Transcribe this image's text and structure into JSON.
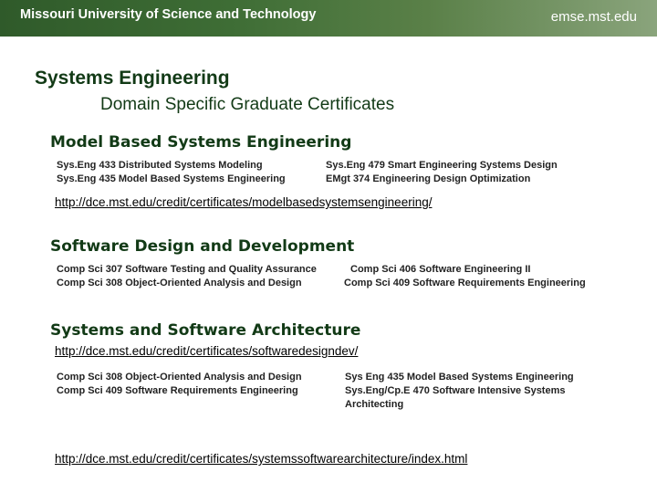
{
  "header": {
    "org": "Missouri University of Science and Technology",
    "site": "emse.mst.edu"
  },
  "title": "Systems Engineering",
  "subtitle": "Domain Specific Graduate Certificates",
  "sections": [
    {
      "heading": "Model Based Systems Engineering",
      "left_courses": [
        "Sys.Eng 433 Distributed Systems Modeling",
        "Sys.Eng 435 Model Based Systems Engineering"
      ],
      "right_courses": [
        "Sys.Eng 479 Smart Engineering Systems Design",
        "EMgt 374 Engineering Design Optimization"
      ],
      "link": "http://dce.mst.edu/credit/certificates/modelbasedsystemsengineering/"
    },
    {
      "heading": "Software Design and Development",
      "left_courses": [
        "Comp Sci 307 Software Testing and Quality Assurance",
        "Comp Sci 308 Object-Oriented Analysis and Design"
      ],
      "right_courses": [
        "Comp Sci 406 Software Engineering II",
        "Comp Sci 409 Software Requirements Engineering"
      ]
    },
    {
      "heading": "Systems and Software Architecture",
      "link_top": "http://dce.mst.edu/credit/certificates/softwaredesigndev/",
      "left_courses": [
        "Comp Sci 308 Object-Oriented Analysis and Design",
        "Comp Sci 409 Software Requirements Engineering"
      ],
      "right_courses": [
        "Sys Eng 435 Model Based Systems Engineering",
        "Sys.Eng/Cp.E 470 Software Intensive Systems",
        "Architecting"
      ],
      "link": "http://dce.mst.edu/credit/certificates/systemssoftwarearchitecture/index.html"
    }
  ]
}
